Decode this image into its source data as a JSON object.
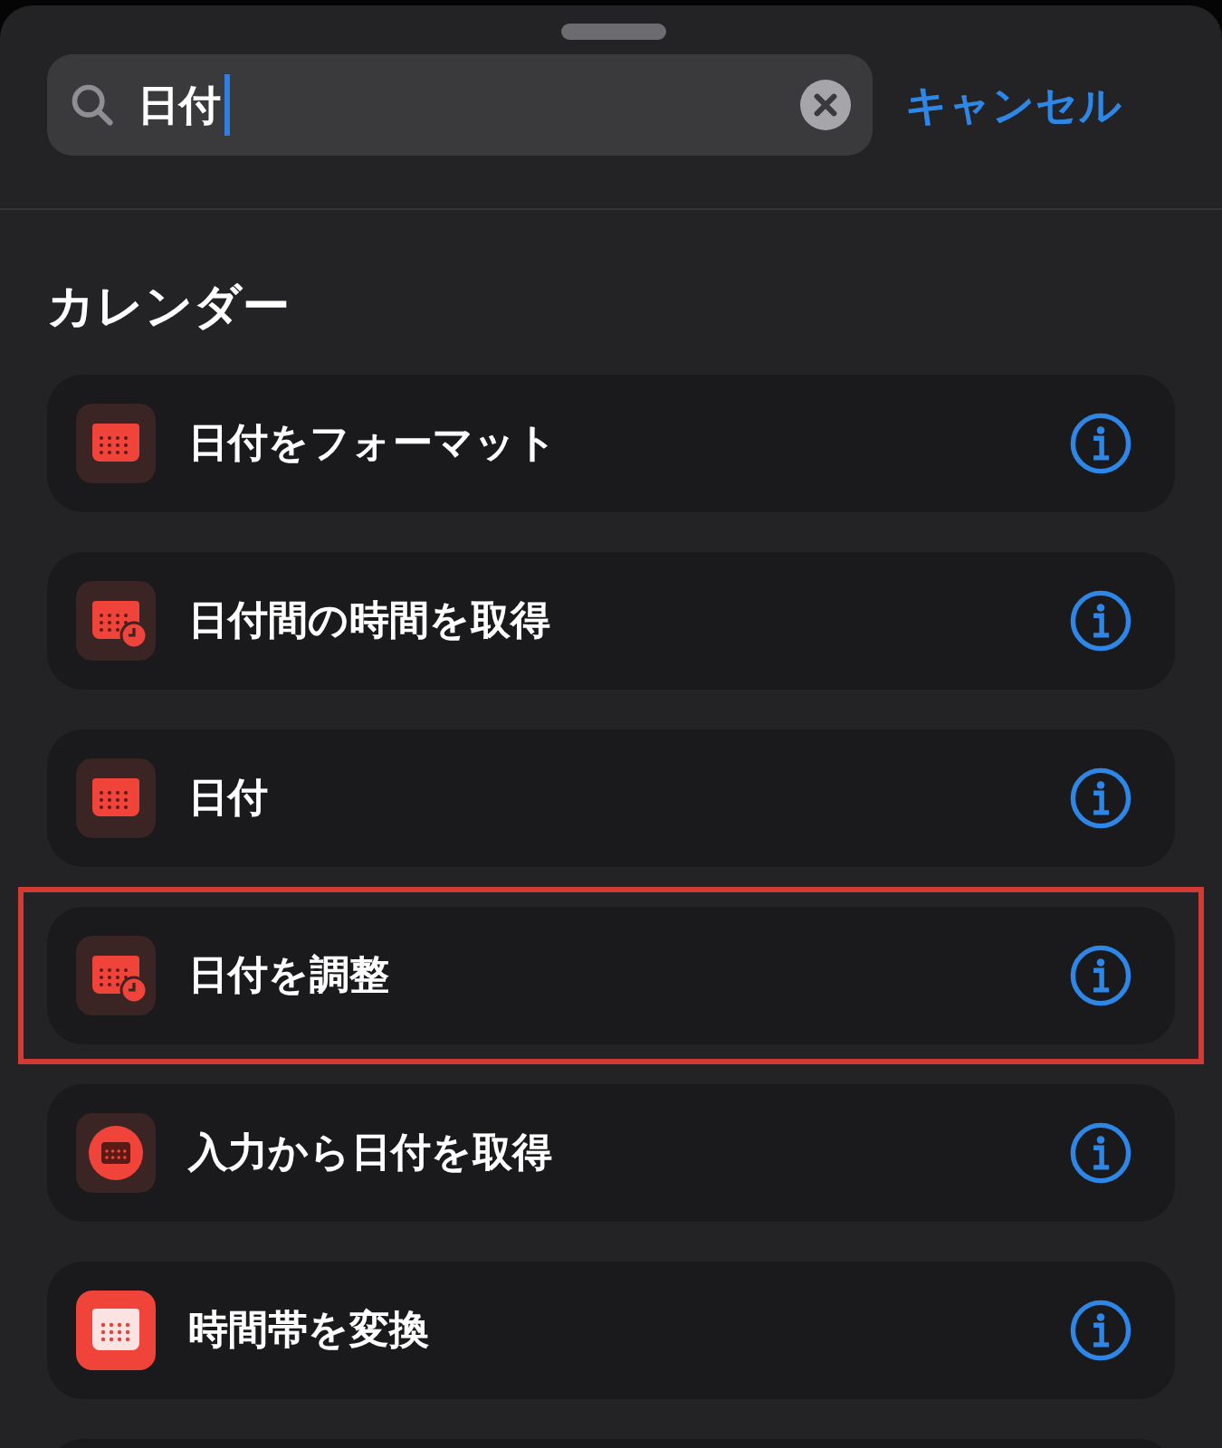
{
  "search": {
    "value": "日付",
    "cancel": "キャンセル"
  },
  "section": {
    "title": "カレンダー"
  },
  "actions": [
    {
      "label": "日付をフォーマット",
      "kind": "calendar",
      "highlighted": false
    },
    {
      "label": "日付間の時間を取得",
      "kind": "calendar-clock",
      "highlighted": false
    },
    {
      "label": "日付",
      "kind": "calendar",
      "highlighted": false
    },
    {
      "label": "日付を調整",
      "kind": "calendar-clock",
      "highlighted": true
    },
    {
      "label": "入力から日付を取得",
      "kind": "round",
      "highlighted": false
    },
    {
      "label": "時間帯を変換",
      "kind": "solid",
      "highlighted": false
    }
  ]
}
